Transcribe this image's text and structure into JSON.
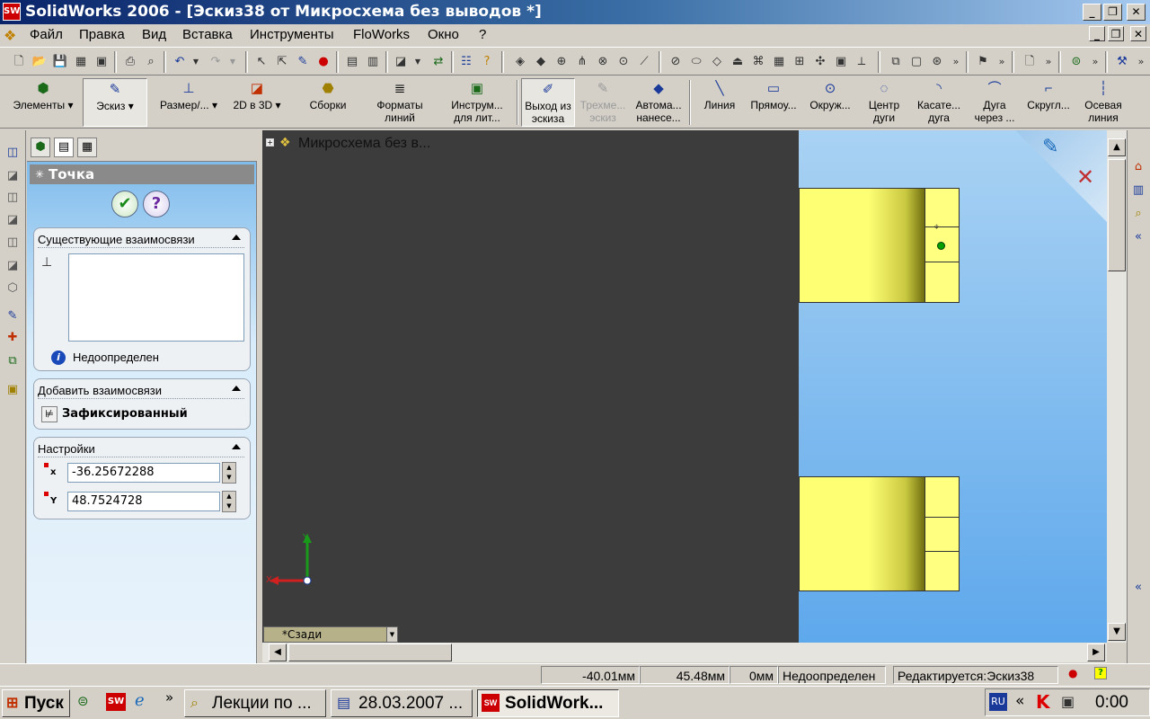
{
  "window": {
    "title": "SolidWorks 2006 - [Эскиз38 от Микросхема без выводов *]",
    "app_logo_text": "SW"
  },
  "menu": [
    "Файл",
    "Правка",
    "Вид",
    "Вставка",
    "Инструменты",
    "FloWorks",
    "Окно",
    "?"
  ],
  "command_manager": [
    {
      "label": "Элементы",
      "state": "normal"
    },
    {
      "label": "Эскиз",
      "state": "active"
    },
    {
      "label": "Размер/...",
      "state": "normal"
    },
    {
      "label": "2D в 3D",
      "state": "normal"
    },
    {
      "label": "Сборки",
      "state": "normal"
    },
    {
      "label": "Форматы линий",
      "state": "normal"
    },
    {
      "label": "Инструм... для лит...",
      "state": "normal"
    },
    {
      "label": "Выход из эскиза",
      "state": "active"
    },
    {
      "label": "Трехме... эскиз",
      "state": "disabled"
    },
    {
      "label": "Автома... нанесе...",
      "state": "normal"
    },
    {
      "label": "Линия",
      "state": "normal"
    },
    {
      "label": "Прямоу...",
      "state": "normal"
    },
    {
      "label": "Окруж...",
      "state": "normal"
    },
    {
      "label": "Центр дуги",
      "state": "normal"
    },
    {
      "label": "Касате... дуга",
      "state": "normal"
    },
    {
      "label": "Дуга через ...",
      "state": "normal"
    },
    {
      "label": "Скругл...",
      "state": "normal"
    },
    {
      "label": "Осевая линия",
      "state": "normal"
    }
  ],
  "property_manager": {
    "title": "Точка",
    "existing_relations": {
      "header": "Существующие взаимосвязи",
      "status": "Недоопределен"
    },
    "add_relations": {
      "header": "Добавить взаимосвязи",
      "fixed_label": "Зафиксированный"
    },
    "settings": {
      "header": "Настройки",
      "x_label": "x",
      "y_label": "Y",
      "x_value": "-36.25672288",
      "y_value": "48.7524728"
    }
  },
  "feature_tree": {
    "root_label": "Микросхема без в..."
  },
  "view": {
    "orientation_label": "*Сзади",
    "axis_x": "X",
    "axis_y": "Y"
  },
  "status_bar": {
    "x": "-40.01мм",
    "y": "45.48мм",
    "z": "0мм",
    "state": "Недоопределен",
    "editing": "Редактируется:Эскиз38"
  },
  "taskbar": {
    "start": "Пуск",
    "tasks": [
      {
        "label": "Лекции по ...",
        "active": false
      },
      {
        "label": "28.03.2007 ...",
        "active": false
      },
      {
        "label": "SolidWork...",
        "active": true
      }
    ],
    "lang": "RU",
    "clock": "0:00"
  },
  "colors": {
    "part_yellow": "#ffff80",
    "viewport_blue": "#5ea8ec",
    "point_green": "#00a000"
  }
}
